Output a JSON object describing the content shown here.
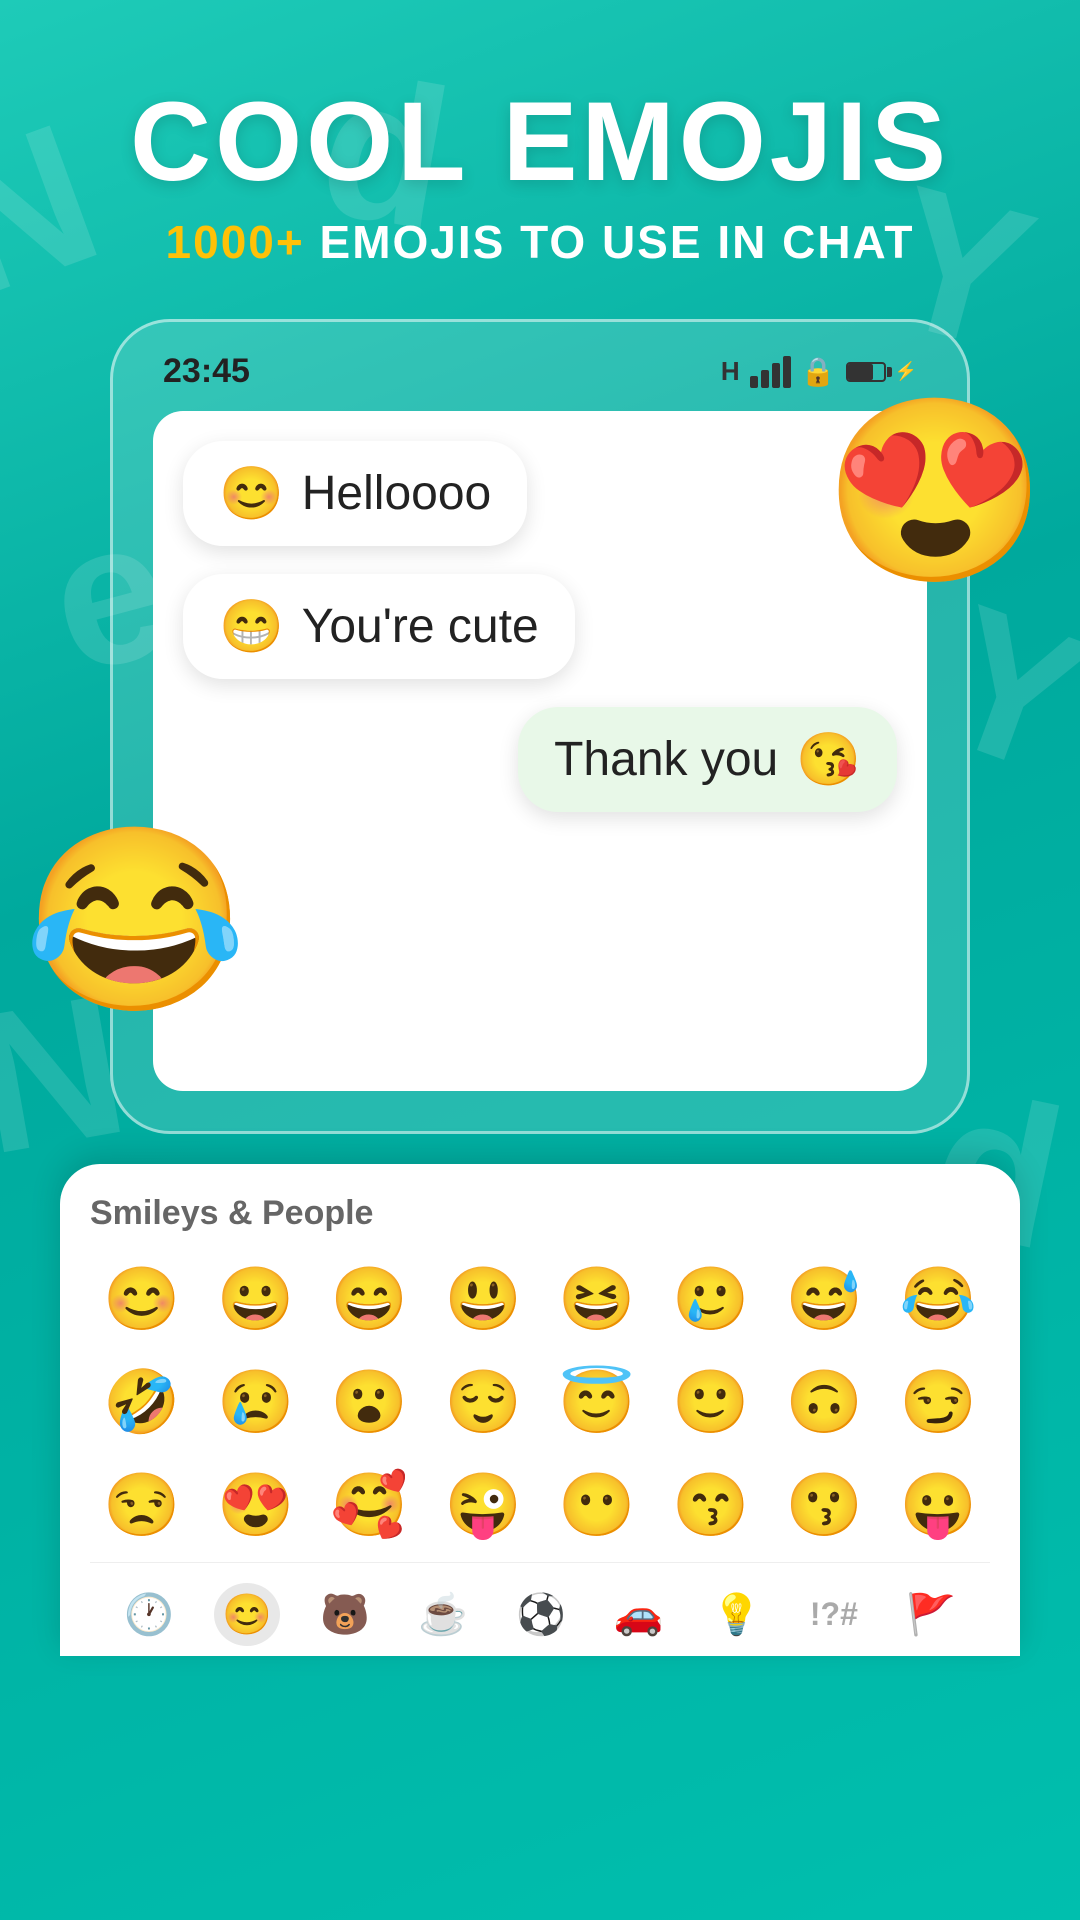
{
  "header": {
    "title": "COOL EMOJIS",
    "subtitle_highlight": "1000+",
    "subtitle_rest": " EMOJIS TO USE IN CHAT"
  },
  "status_bar": {
    "time": "23:45",
    "network": "H",
    "lock_icon": "🔒"
  },
  "messages": [
    {
      "id": "msg1",
      "text": "Helloooo",
      "emoji": "😊",
      "sent": false
    },
    {
      "id": "msg2",
      "text": "You're cute",
      "emoji": "😁",
      "sent": false
    },
    {
      "id": "msg3",
      "text": "Thank you",
      "emoji": "😘",
      "sent": true
    }
  ],
  "floating_emojis": {
    "right": "😍",
    "left": "😂"
  },
  "keyboard": {
    "section_title": "Smileys & People",
    "emojis_row1": [
      "😊",
      "😀",
      "😄",
      "😃",
      "😆",
      "🥲",
      "😅",
      "😂"
    ],
    "emojis_row2": [
      "🤣",
      "😢",
      "😮",
      "😌",
      "😇",
      "🙂",
      "🙃",
      "😏"
    ],
    "emojis_row3": [
      "😒",
      "😍",
      "🥰",
      "😜",
      "😶",
      "😙",
      "😗",
      "😛"
    ],
    "categories": [
      {
        "icon": "🕐",
        "label": "recent",
        "active": false
      },
      {
        "icon": "😊",
        "label": "smileys",
        "active": true
      },
      {
        "icon": "🐻",
        "label": "animals",
        "active": false
      },
      {
        "icon": "☕",
        "label": "food",
        "active": false
      },
      {
        "icon": "⚽",
        "label": "activities",
        "active": false
      },
      {
        "icon": "🚗",
        "label": "travel",
        "active": false
      },
      {
        "icon": "💡",
        "label": "objects",
        "active": false
      },
      {
        "icon": "🔣",
        "label": "symbols",
        "active": false
      },
      {
        "icon": "🚩",
        "label": "flags",
        "active": false
      }
    ]
  }
}
